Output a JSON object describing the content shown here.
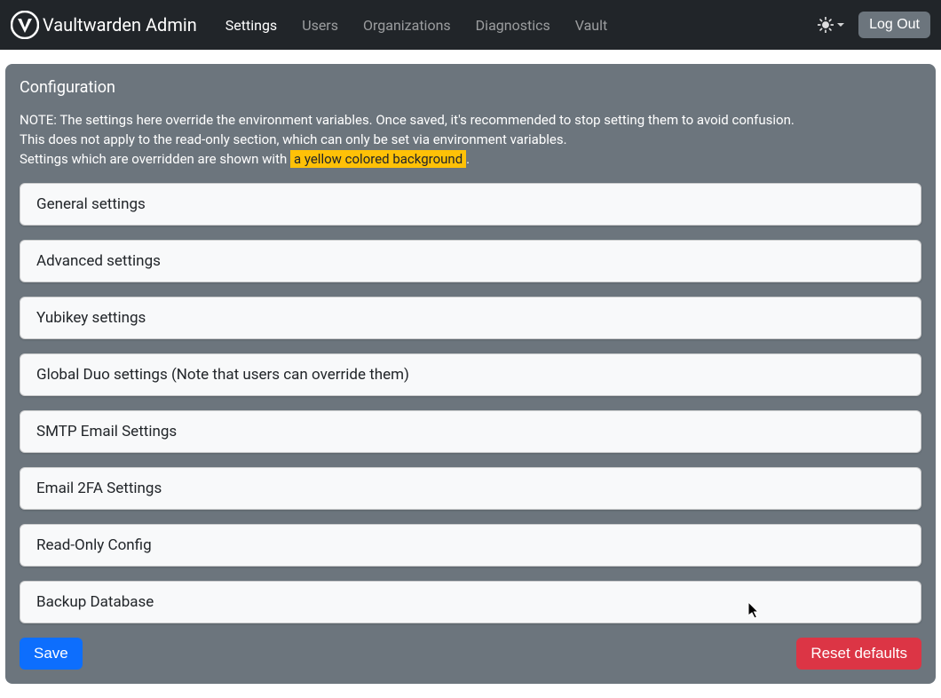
{
  "brand": {
    "name": "Vaultwarden Admin"
  },
  "nav": {
    "items": [
      {
        "label": "Settings",
        "active": true
      },
      {
        "label": "Users",
        "active": false
      },
      {
        "label": "Organizations",
        "active": false
      },
      {
        "label": "Diagnostics",
        "active": false
      },
      {
        "label": "Vault",
        "active": false
      }
    ],
    "logout": "Log Out"
  },
  "config": {
    "title": "Configuration",
    "note_line1": "NOTE: The settings here override the environment variables. Once saved, it's recommended to stop setting them to avoid confusion.",
    "note_line2": "This does not apply to the read-only section, which can only be set via environment variables.",
    "note_line3_prefix": "Settings which are overridden are shown with ",
    "note_line3_highlight": "a yellow colored background",
    "note_line3_suffix": ".",
    "sections": [
      {
        "label": "General settings"
      },
      {
        "label": "Advanced settings"
      },
      {
        "label": "Yubikey settings"
      },
      {
        "label": "Global Duo settings (Note that users can override them)"
      },
      {
        "label": "SMTP Email Settings"
      },
      {
        "label": "Email 2FA Settings"
      },
      {
        "label": "Read-Only Config"
      },
      {
        "label": "Backup Database"
      }
    ],
    "save_label": "Save",
    "reset_label": "Reset defaults"
  }
}
